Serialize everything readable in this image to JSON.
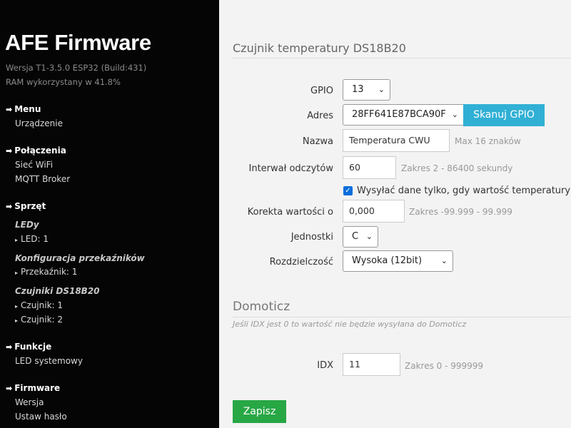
{
  "sidebar": {
    "brand": "AFE Firmware",
    "version": "Wersja T1-3.5.0 ESP32 (Build:431)",
    "ram": "RAM wykorzystany w 41.8%",
    "arrow": "➡",
    "bullet": "▸",
    "menu": {
      "title": "Menu",
      "items": [
        "Urządzenie"
      ]
    },
    "connections": {
      "title": "Połączenia",
      "items": [
        "Sieć WiFi",
        "MQTT Broker"
      ]
    },
    "hardware": {
      "title": "Sprzęt",
      "leds": {
        "title": "LEDy",
        "items": [
          "LED: 1"
        ]
      },
      "relays": {
        "title": "Konfiguracja przekaźników",
        "items": [
          "Przekaźnik: 1"
        ]
      },
      "sensors": {
        "title": "Czujniki DS18B20",
        "items": [
          "Czujnik: 1",
          "Czujnik: 2"
        ]
      }
    },
    "functions": {
      "title": "Funkcje",
      "items": [
        "LED systemowy"
      ]
    },
    "firmware": {
      "title": "Firmware",
      "items": [
        "Wersja",
        "Ustaw hasło"
      ]
    }
  },
  "form": {
    "title": "Czujnik temperatury DS18B20",
    "gpio": {
      "label": "GPIO",
      "value": "13"
    },
    "address": {
      "label": "Adres",
      "value": "28FF641E87BCA90F",
      "scan_button": "Skanuj GPIO"
    },
    "name": {
      "label": "Nazwa",
      "value": "Temperatura CWU",
      "hint": "Max 16 znaków"
    },
    "interval": {
      "label": "Interwał odczytów",
      "value": "60",
      "hint": "Zakres 2 - 86400 sekundy"
    },
    "send_on_change": {
      "label": "Wysyłać dane tylko, gdy wartość temperatury zmien",
      "checked": true,
      "check_glyph": "✓"
    },
    "correction": {
      "label": "Korekta wartości o",
      "value": "0,000",
      "hint": "Zakres -99.999 - 99.999"
    },
    "units": {
      "label": "Jednostki",
      "value": "C"
    },
    "resolution": {
      "label": "Rozdzielczość",
      "value": "Wysoka (12bit)"
    },
    "chevron": "⌄"
  },
  "domoticz": {
    "title": "Domoticz",
    "note": "Jeśli IDX jest 0 to wartość nie będzie wysyłana do Domoticz",
    "idx": {
      "label": "IDX",
      "value": "11",
      "hint": "Zakres 0 - 999999"
    }
  },
  "save_button": "Zapisz",
  "colors": {
    "sidebar_bg": "#050505",
    "scan_button": "#31b0d5",
    "save_button": "#28a745",
    "checkbox": "#0a6edb"
  }
}
